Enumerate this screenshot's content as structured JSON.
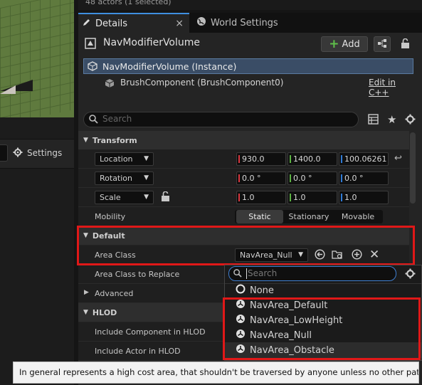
{
  "top_status": "48 actors (1 selected)",
  "left_panel": {
    "settings_label": "Settings"
  },
  "tabs": [
    {
      "label": "Details",
      "close": "×"
    },
    {
      "label": "World Settings"
    }
  ],
  "header": {
    "title": "NavModifierVolume",
    "add_label": "Add"
  },
  "components": {
    "instance": "NavModifierVolume (Instance)",
    "brush": "BrushComponent (BrushComponent0)",
    "edit_link": "Edit in C++"
  },
  "search": {
    "placeholder": "Search"
  },
  "transform": {
    "title": "Transform",
    "location": {
      "label": "Location",
      "x": "930.0",
      "y": "1400.0",
      "z": "100.06261"
    },
    "rotation": {
      "label": "Rotation",
      "x": "0.0 °",
      "y": "0.0 °",
      "z": "0.0 °"
    },
    "scale": {
      "label": "Scale",
      "x": "1.0",
      "y": "1.0",
      "z": "1.0"
    },
    "mobility": {
      "label": "Mobility",
      "options": [
        "Static",
        "Stationary",
        "Movable"
      ],
      "selected": "Static"
    }
  },
  "default_section": {
    "title": "Default",
    "area_class": {
      "label": "Area Class",
      "value": "NavArea_Null"
    },
    "area_class_replace": {
      "label": "Area Class to Replace"
    },
    "advanced": {
      "label": "Advanced"
    }
  },
  "hlod": {
    "title": "HLOD",
    "include_component": "Include Component in HLOD",
    "include_actor": "Include Actor in HLOD"
  },
  "dropdown": {
    "search_placeholder": "Search",
    "items": [
      "None",
      "NavArea_Default",
      "NavArea_LowHeight",
      "NavArea_Null",
      "NavArea_Obstacle"
    ]
  },
  "tooltip": "In general represents a high cost area, that shouldn't be traversed by anyone unless no other path exist.",
  "colors": {
    "accent": "#3f8fe0",
    "highlight": "#e01818",
    "x_axis": "#d9363e",
    "y_axis": "#5bb342",
    "z_axis": "#2f7bd6"
  }
}
